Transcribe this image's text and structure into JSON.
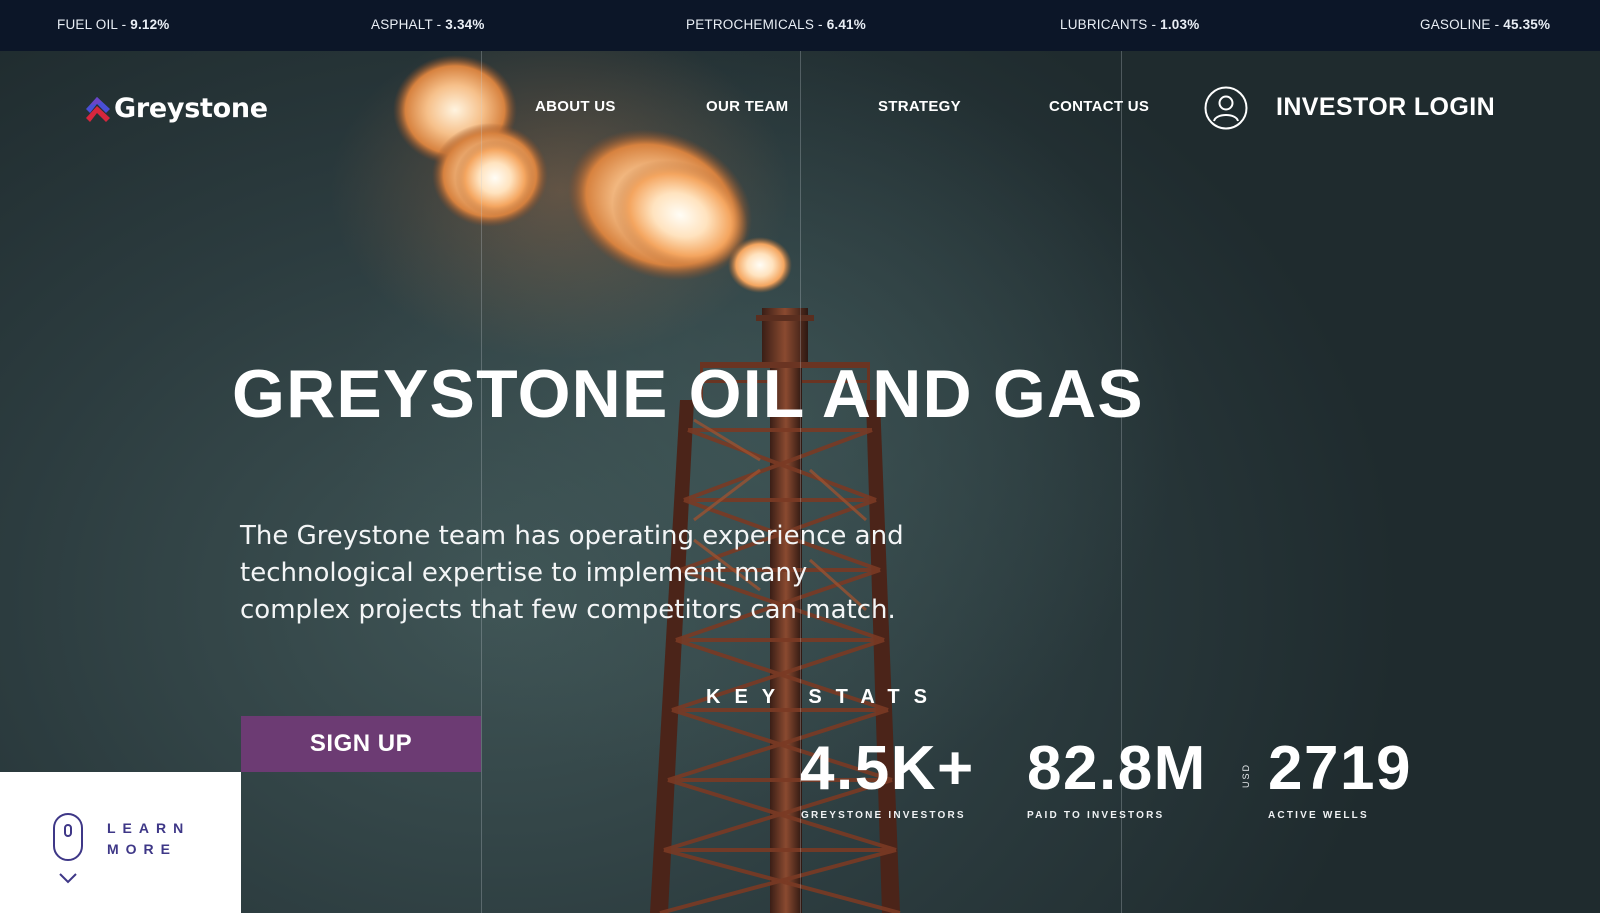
{
  "ticker": [
    {
      "name": "FUEL OIL",
      "value": "9.12%"
    },
    {
      "name": "ASPHALT",
      "value": "3.34%"
    },
    {
      "name": "PETROCHEMICALS",
      "value": "6.41%"
    },
    {
      "name": "LUBRICANTS",
      "value": "1.03%"
    },
    {
      "name": "GASOLINE",
      "value": "45.35%"
    }
  ],
  "ticker_separator": " - ",
  "brand": {
    "name": "Greystone"
  },
  "nav": {
    "links": [
      "ABOUT US",
      "OUR TEAM",
      "STRATEGY",
      "CONTACT US"
    ],
    "login_label": "INVESTOR LOGIN"
  },
  "hero": {
    "title": "GREYSTONE OIL AND GAS",
    "description": "The Greystone team has operating experience and technological expertise to implement many complex projects that few competitors can match.",
    "signup_label": "SIGN UP"
  },
  "stats": {
    "heading": "KEY STATS",
    "items": [
      {
        "value": "4.5K+",
        "label": "GREYSTONE INVESTORS"
      },
      {
        "value": "82.8M",
        "label": "PAID TO INVESTORS",
        "unit": "USD"
      },
      {
        "value": "2719",
        "label": "ACTIVE WELLS"
      }
    ]
  },
  "learn_more": {
    "line1": "LEARN",
    "line2": "MORE"
  },
  "colors": {
    "ticker_bg": "#0c1628",
    "accent_purple": "#6c3b73",
    "learn_text": "#3e3787",
    "logo_red": "#d7263d",
    "logo_blue": "#4a4fd6"
  }
}
